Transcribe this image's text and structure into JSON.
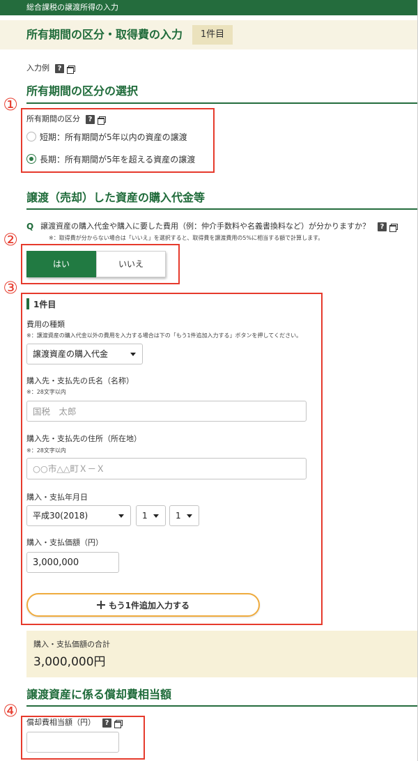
{
  "app": {
    "header_title": "総合課税の譲渡所得の入力"
  },
  "page_header": {
    "title": "所有期間の区分・取得費の入力",
    "badge": "1件目"
  },
  "icons": {
    "help_glyph": "?",
    "help": "help-icon",
    "new_window": "open-new-window-icon",
    "select_caret": "caret-down-icon",
    "add": "plus-icon"
  },
  "example": {
    "label": "入力例"
  },
  "holding_period": {
    "section_title": "所有期間の区分の選択",
    "annotation": "①",
    "field_label": "所有期間の区分",
    "options": [
      {
        "label": "短期：所有期間が5年以内の資産の譲渡",
        "checked": false
      },
      {
        "label": "長期：所有期間が5年を超える資産の譲渡",
        "checked": true
      }
    ]
  },
  "purchase": {
    "section_title": "譲渡（売却）した資産の購入代金等",
    "question_marker": "Q",
    "question": "譲渡資産の購入代金や購入に要した費用（例：仲介手数料や名義書換料など）が分かりますか？",
    "question_note": "※：取得費が分からない場合は「いいえ」を選択すると、取得費を譲渡費用の5%に相当する額で計算します。",
    "annotation_toggle": "②",
    "toggle": [
      {
        "label": "はい",
        "selected": true
      },
      {
        "label": "いいえ",
        "selected": false
      }
    ],
    "annotation_entry": "③",
    "entry": {
      "title": "1件目",
      "cost_type_label": "費用の種類",
      "cost_type_note": "※：譲渡資産の購入代金以外の費用を入力する場合は下の「もう1件追加入力する」ボタンを押してください。",
      "cost_type_value": "譲渡資産の購入代金",
      "name_label": "購入先・支払先の氏名（名称）",
      "name_note": "※：28文字以内",
      "name_placeholder": "国税　太郎",
      "address_label": "購入先・支払先の住所（所在地）",
      "address_note": "※：28文字以内",
      "address_placeholder": "○○市△△町Ｘ－Ｘ",
      "date_label": "購入・支払年月日",
      "date_year": "平成30(2018)",
      "date_month": "1",
      "date_day": "1",
      "price_label": "購入・支払価額（円）",
      "price_value": "3,000,000",
      "add_button_label": "もう1件追加入力する"
    },
    "total_label": "購入・支払価額の合計",
    "total_value": "3,000,000円"
  },
  "depreciation": {
    "section_title": "譲渡資産に係る償却費相当額",
    "annotation": "④",
    "field_label": "償却費相当額（円）"
  },
  "colors": {
    "brand_green": "#246c3d",
    "title_green": "#1f6b3a",
    "header_cream": "#f7f3e3",
    "badge_cream": "#ebe2bd",
    "total_cream": "#f7f1d8",
    "annotation_red": "#e63a2c",
    "button_orange": "#efab3d",
    "toggle_green": "#217a42",
    "radio_green": "#2e7b47"
  }
}
